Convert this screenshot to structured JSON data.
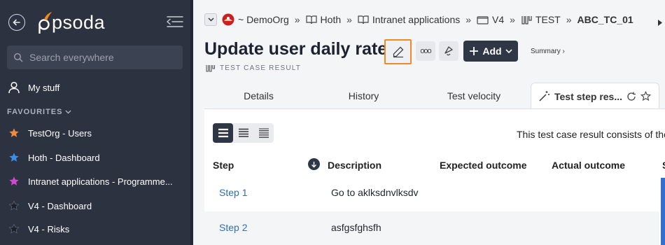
{
  "app": {
    "logo_text": "psoda"
  },
  "sidebar": {
    "search_placeholder": "Search everywhere",
    "my_stuff": "My stuff",
    "favourites_label": "FAVOURITES",
    "favourites": [
      {
        "label": "TestOrg - Users",
        "star_color": "#f08a3c"
      },
      {
        "label": "Hoth - Dashboard",
        "star_color": "#3b8ee6"
      },
      {
        "label": "Intranet applications - Programme...",
        "star_color": "#d04ad0"
      },
      {
        "label": "V4 - Dashboard",
        "star_color": "#1d2028"
      },
      {
        "label": "V4 - Risks",
        "star_color": "#1d2028"
      }
    ]
  },
  "breadcrumb": {
    "items": [
      "~ DemoOrg",
      "Hoth",
      "Intranet applications",
      "V4",
      "TEST",
      "ABC_TC_01"
    ],
    "separator": "»"
  },
  "page": {
    "title": "Update user daily rate",
    "subtitle": "TEST CASE RESULT",
    "more_label": "ooo",
    "add_label": "Add",
    "summary_label": "Summary ›"
  },
  "tabs": [
    {
      "label": "Details"
    },
    {
      "label": "History"
    },
    {
      "label": "Test velocity"
    },
    {
      "label": "Test step res..."
    }
  ],
  "panel": {
    "info_text": "This test case result consists of the",
    "columns": [
      "Step",
      "Description",
      "Expected outcome",
      "Actual outcome",
      "S"
    ],
    "rows": [
      {
        "step": "Step 1",
        "description": "Go to aklksdnvlksdv"
      },
      {
        "step": "Step 2",
        "description": "asfgsfghsfh"
      }
    ]
  },
  "colors": {
    "accent": "#f08a24",
    "sidebar_bg": "#2c3240",
    "link": "#2f6fb3",
    "dark_button": "#2f3747"
  }
}
